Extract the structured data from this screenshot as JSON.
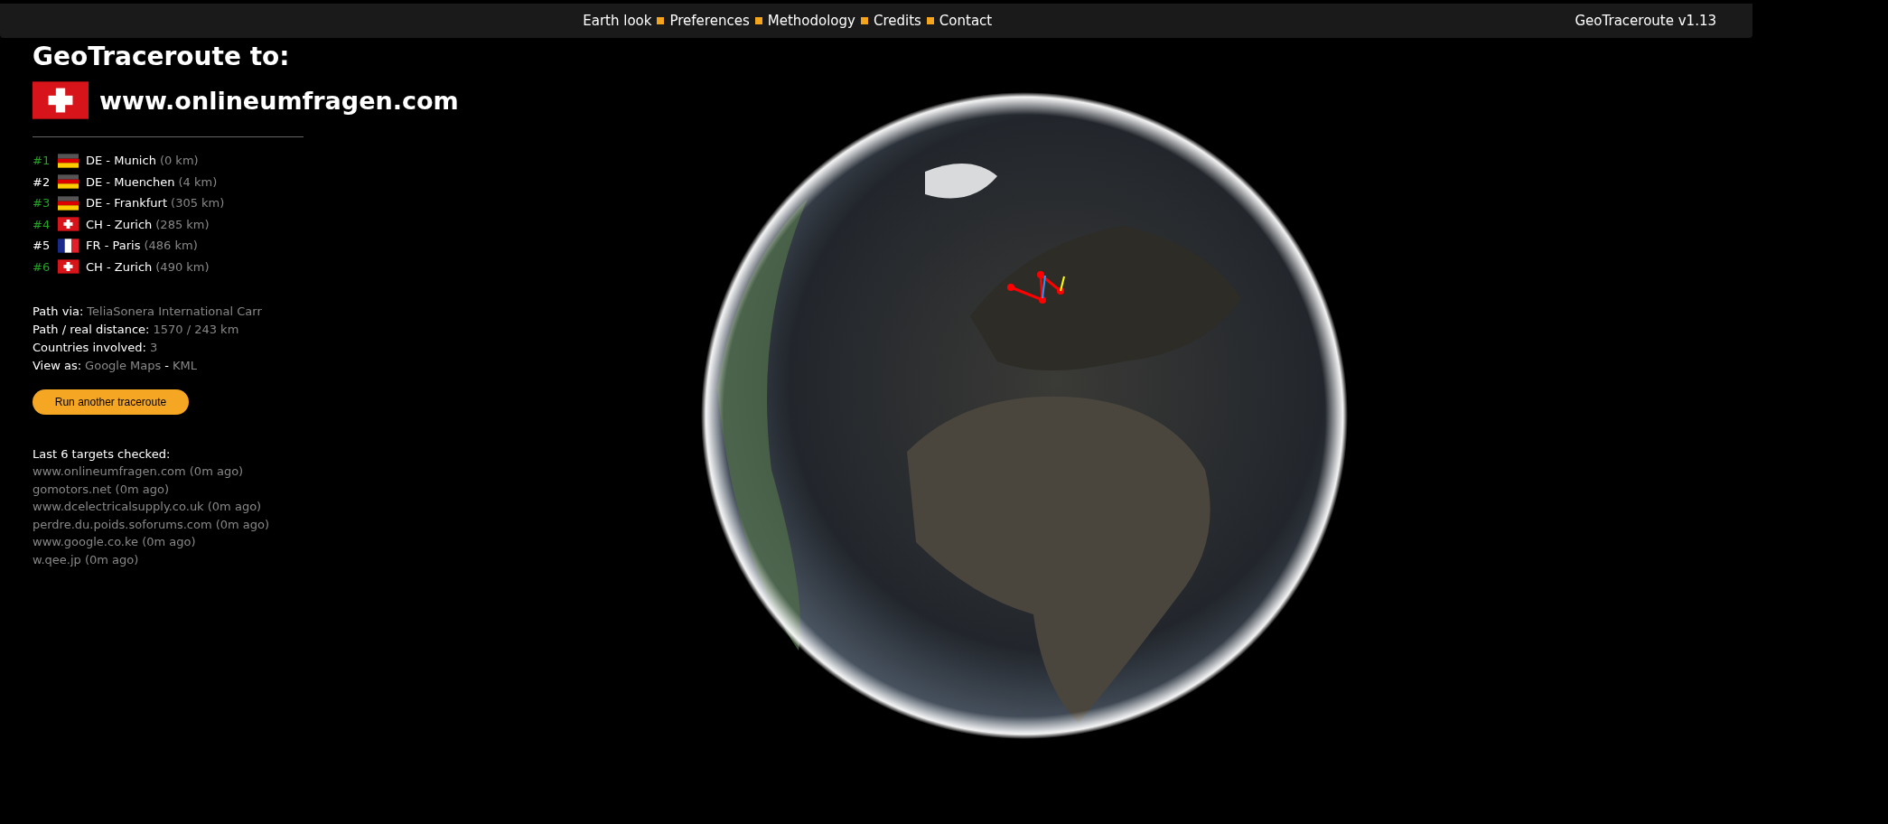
{
  "nav": {
    "links": [
      "Earth look",
      "Preferences",
      "Methodology",
      "Credits",
      "Contact"
    ],
    "version": "GeoTraceroute v1.13"
  },
  "heading": "GeoTraceroute to:",
  "target": {
    "kind": "ch",
    "host": "www.onlineumfragen.com"
  },
  "hops": [
    {
      "number": "#1",
      "highlighted": true,
      "kind": "de",
      "place": "DE - Munich",
      "distance": "(0 km)"
    },
    {
      "number": "#2",
      "highlighted": false,
      "kind": "de",
      "place": "DE - Muenchen",
      "distance": "(4 km)"
    },
    {
      "number": "#3",
      "highlighted": true,
      "kind": "de",
      "place": "DE - Frankfurt",
      "distance": "(305 km)"
    },
    {
      "number": "#4",
      "highlighted": true,
      "kind": "ch",
      "place": "CH - Zurich",
      "distance": "(285 km)"
    },
    {
      "number": "#5",
      "highlighted": false,
      "kind": "fr",
      "place": "FR - Paris",
      "distance": "(486 km)"
    },
    {
      "number": "#6",
      "highlighted": true,
      "kind": "ch",
      "place": "CH - Zurich",
      "distance": "(490 km)"
    }
  ],
  "summary": [
    {
      "label": "Path via:",
      "values": [
        "TeliaSonera International Carr"
      ]
    },
    {
      "label": "Path / real distance:",
      "values": [
        "1570 / 243 km"
      ]
    },
    {
      "label": "Countries involved:",
      "values": [
        "3"
      ]
    },
    {
      "label": "View as:",
      "values": [
        "Google Maps",
        "KML"
      ],
      "separator": "-"
    }
  ],
  "button": "Run another traceroute",
  "recent": {
    "title": "Last 6 targets checked:",
    "items": [
      "www.onlineumfragen.com (0m ago)",
      "gomotors.net (0m ago)",
      "www.dcelectricalsupply.co.uk (0m ago)",
      "perdre.du.poids.soforums.com (0m ago)",
      "www.google.co.ke (0m ago)",
      "w.qee.jp (0m ago)"
    ]
  }
}
